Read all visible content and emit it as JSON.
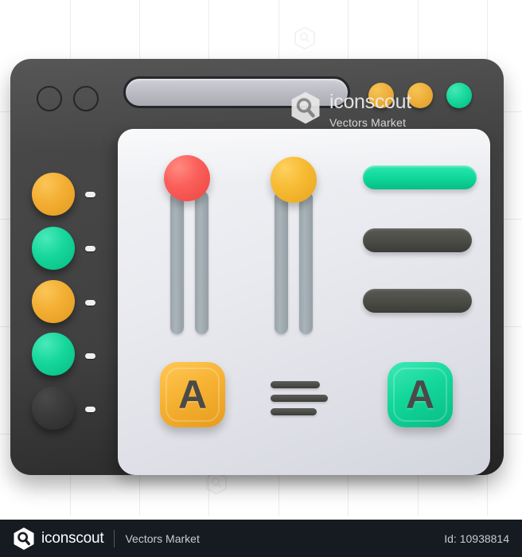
{
  "footer": {
    "brand": "iconscout",
    "vendor": "Vectors Market",
    "id_label": "Id: 10938814",
    "logo_icon": "iconscout-hex-logo-icon"
  },
  "watermark": {
    "brand": "iconscout",
    "tagline": "Vectors Market",
    "logo_icon": "iconscout-hex-logo-icon",
    "bg_marks_icon": "hex-search-watermark-icon"
  },
  "window": {
    "titlebar": {
      "control_dots": [
        {
          "name": "window-control-dot-1",
          "style": "outline"
        },
        {
          "name": "window-control-dot-2",
          "style": "outline"
        }
      ],
      "search": {
        "value": "",
        "placeholder": ""
      },
      "status_dots": [
        {
          "name": "status-dot-amber-1",
          "color": "#eeaf3c"
        },
        {
          "name": "status-dot-amber-2",
          "color": "#eeaf3c"
        },
        {
          "name": "status-dot-green",
          "color": "#16d79b"
        }
      ]
    },
    "sidebar": {
      "items": [
        {
          "name": "sidebar-swatch-1",
          "color": "#f3ae33",
          "kind": "orange"
        },
        {
          "name": "sidebar-swatch-2",
          "color": "#16d79b",
          "kind": "green"
        },
        {
          "name": "sidebar-swatch-3",
          "color": "#f3ae33",
          "kind": "orange"
        },
        {
          "name": "sidebar-swatch-4",
          "color": "#16d79b",
          "kind": "green"
        },
        {
          "name": "sidebar-swatch-5",
          "color": "#3a3a3a",
          "kind": "dark"
        }
      ]
    },
    "panel": {
      "sliders": [
        {
          "name": "slider-red",
          "knob_color": "#fb5f5a",
          "value_label": ""
        },
        {
          "name": "slider-amber",
          "knob_color": "#f7bb34",
          "value_label": ""
        }
      ],
      "bars": [
        {
          "name": "option-bar-green",
          "color": "#0fd69a",
          "label": ""
        },
        {
          "name": "option-bar-dark-1",
          "color": "#4b4b46",
          "label": ""
        },
        {
          "name": "option-bar-dark-2",
          "color": "#4b4b46",
          "label": ""
        }
      ],
      "font_buttons": [
        {
          "name": "font-button-orange",
          "glyph": "A",
          "color": "#f6b233"
        },
        {
          "name": "font-button-green",
          "glyph": "A",
          "color": "#13d79a"
        }
      ],
      "align_lines": {
        "name": "text-align-lines-icon",
        "widths": [
          62,
          72,
          58
        ]
      }
    }
  },
  "colors": {
    "accent_green": "#16d79b",
    "accent_orange": "#f3ae33",
    "accent_red": "#fb5f5a",
    "window_dark": "#3e3e3e",
    "panel_light": "#e9eaef",
    "footer_dark": "#161b22"
  }
}
